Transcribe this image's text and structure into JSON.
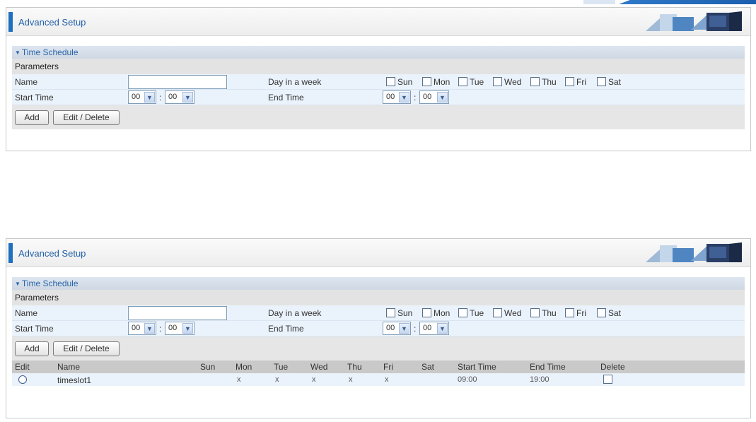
{
  "window_title": "Advanced Setup",
  "section_title": "Time Schedule",
  "params_label": "Parameters",
  "form": {
    "name_label": "Name",
    "name_value": "",
    "day_label": "Day in a week",
    "days": [
      "Sun",
      "Mon",
      "Tue",
      "Wed",
      "Thu",
      "Fri",
      "Sat"
    ],
    "start_label": "Start Time",
    "end_label": "End Time",
    "start_hour": "00",
    "start_min": "00",
    "end_hour": "00",
    "end_min": "00",
    "colon": ":"
  },
  "buttons": {
    "add": "Add",
    "edit_delete": "Edit / Delete"
  },
  "table": {
    "headers": [
      "Edit",
      "Name",
      "Sun",
      "Mon",
      "Tue",
      "Wed",
      "Thu",
      "Fri",
      "Sat",
      "Start Time",
      "End Time",
      "Delete"
    ],
    "rows": [
      {
        "name": "timeslot1",
        "sun": "",
        "mon": "x",
        "tue": "x",
        "wed": "x",
        "thu": "x",
        "fri": "x",
        "sat": "",
        "start": "09:00",
        "end": "19:00"
      }
    ]
  },
  "colors": {
    "accent": "#1f6fbf",
    "title": "#1f5fa8",
    "row_blue": "#eaf2fb"
  }
}
